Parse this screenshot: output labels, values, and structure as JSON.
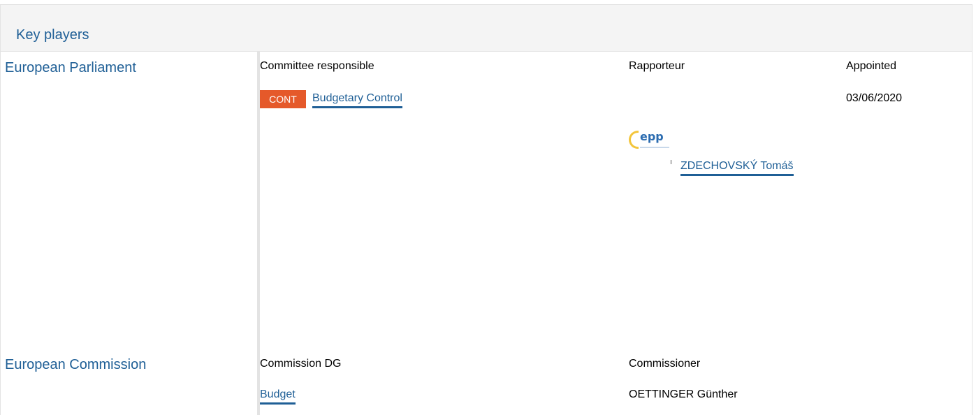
{
  "header": {
    "title": "Key players"
  },
  "parliament": {
    "title": "European Parliament",
    "col_committee": "Committee responsible",
    "col_rapporteur": "Rapporteur",
    "col_appointed": "Appointed",
    "committee_code": "CONT",
    "committee_name": "Budgetary Control",
    "appointed_date": "03/06/2020",
    "rapporteur_group_logo": "epp",
    "rapporteur_name": "ZDECHOVSKÝ Tomáš"
  },
  "commission": {
    "title": "European Commission",
    "col_dg": "Commission DG",
    "col_commissioner": "Commissioner",
    "dg_name": "Budget",
    "commissioner_name": "OETTINGER Günther"
  },
  "colors": {
    "link": "#1f5f96",
    "badge": "#e5592a",
    "header_bg": "#f4f4f4"
  }
}
